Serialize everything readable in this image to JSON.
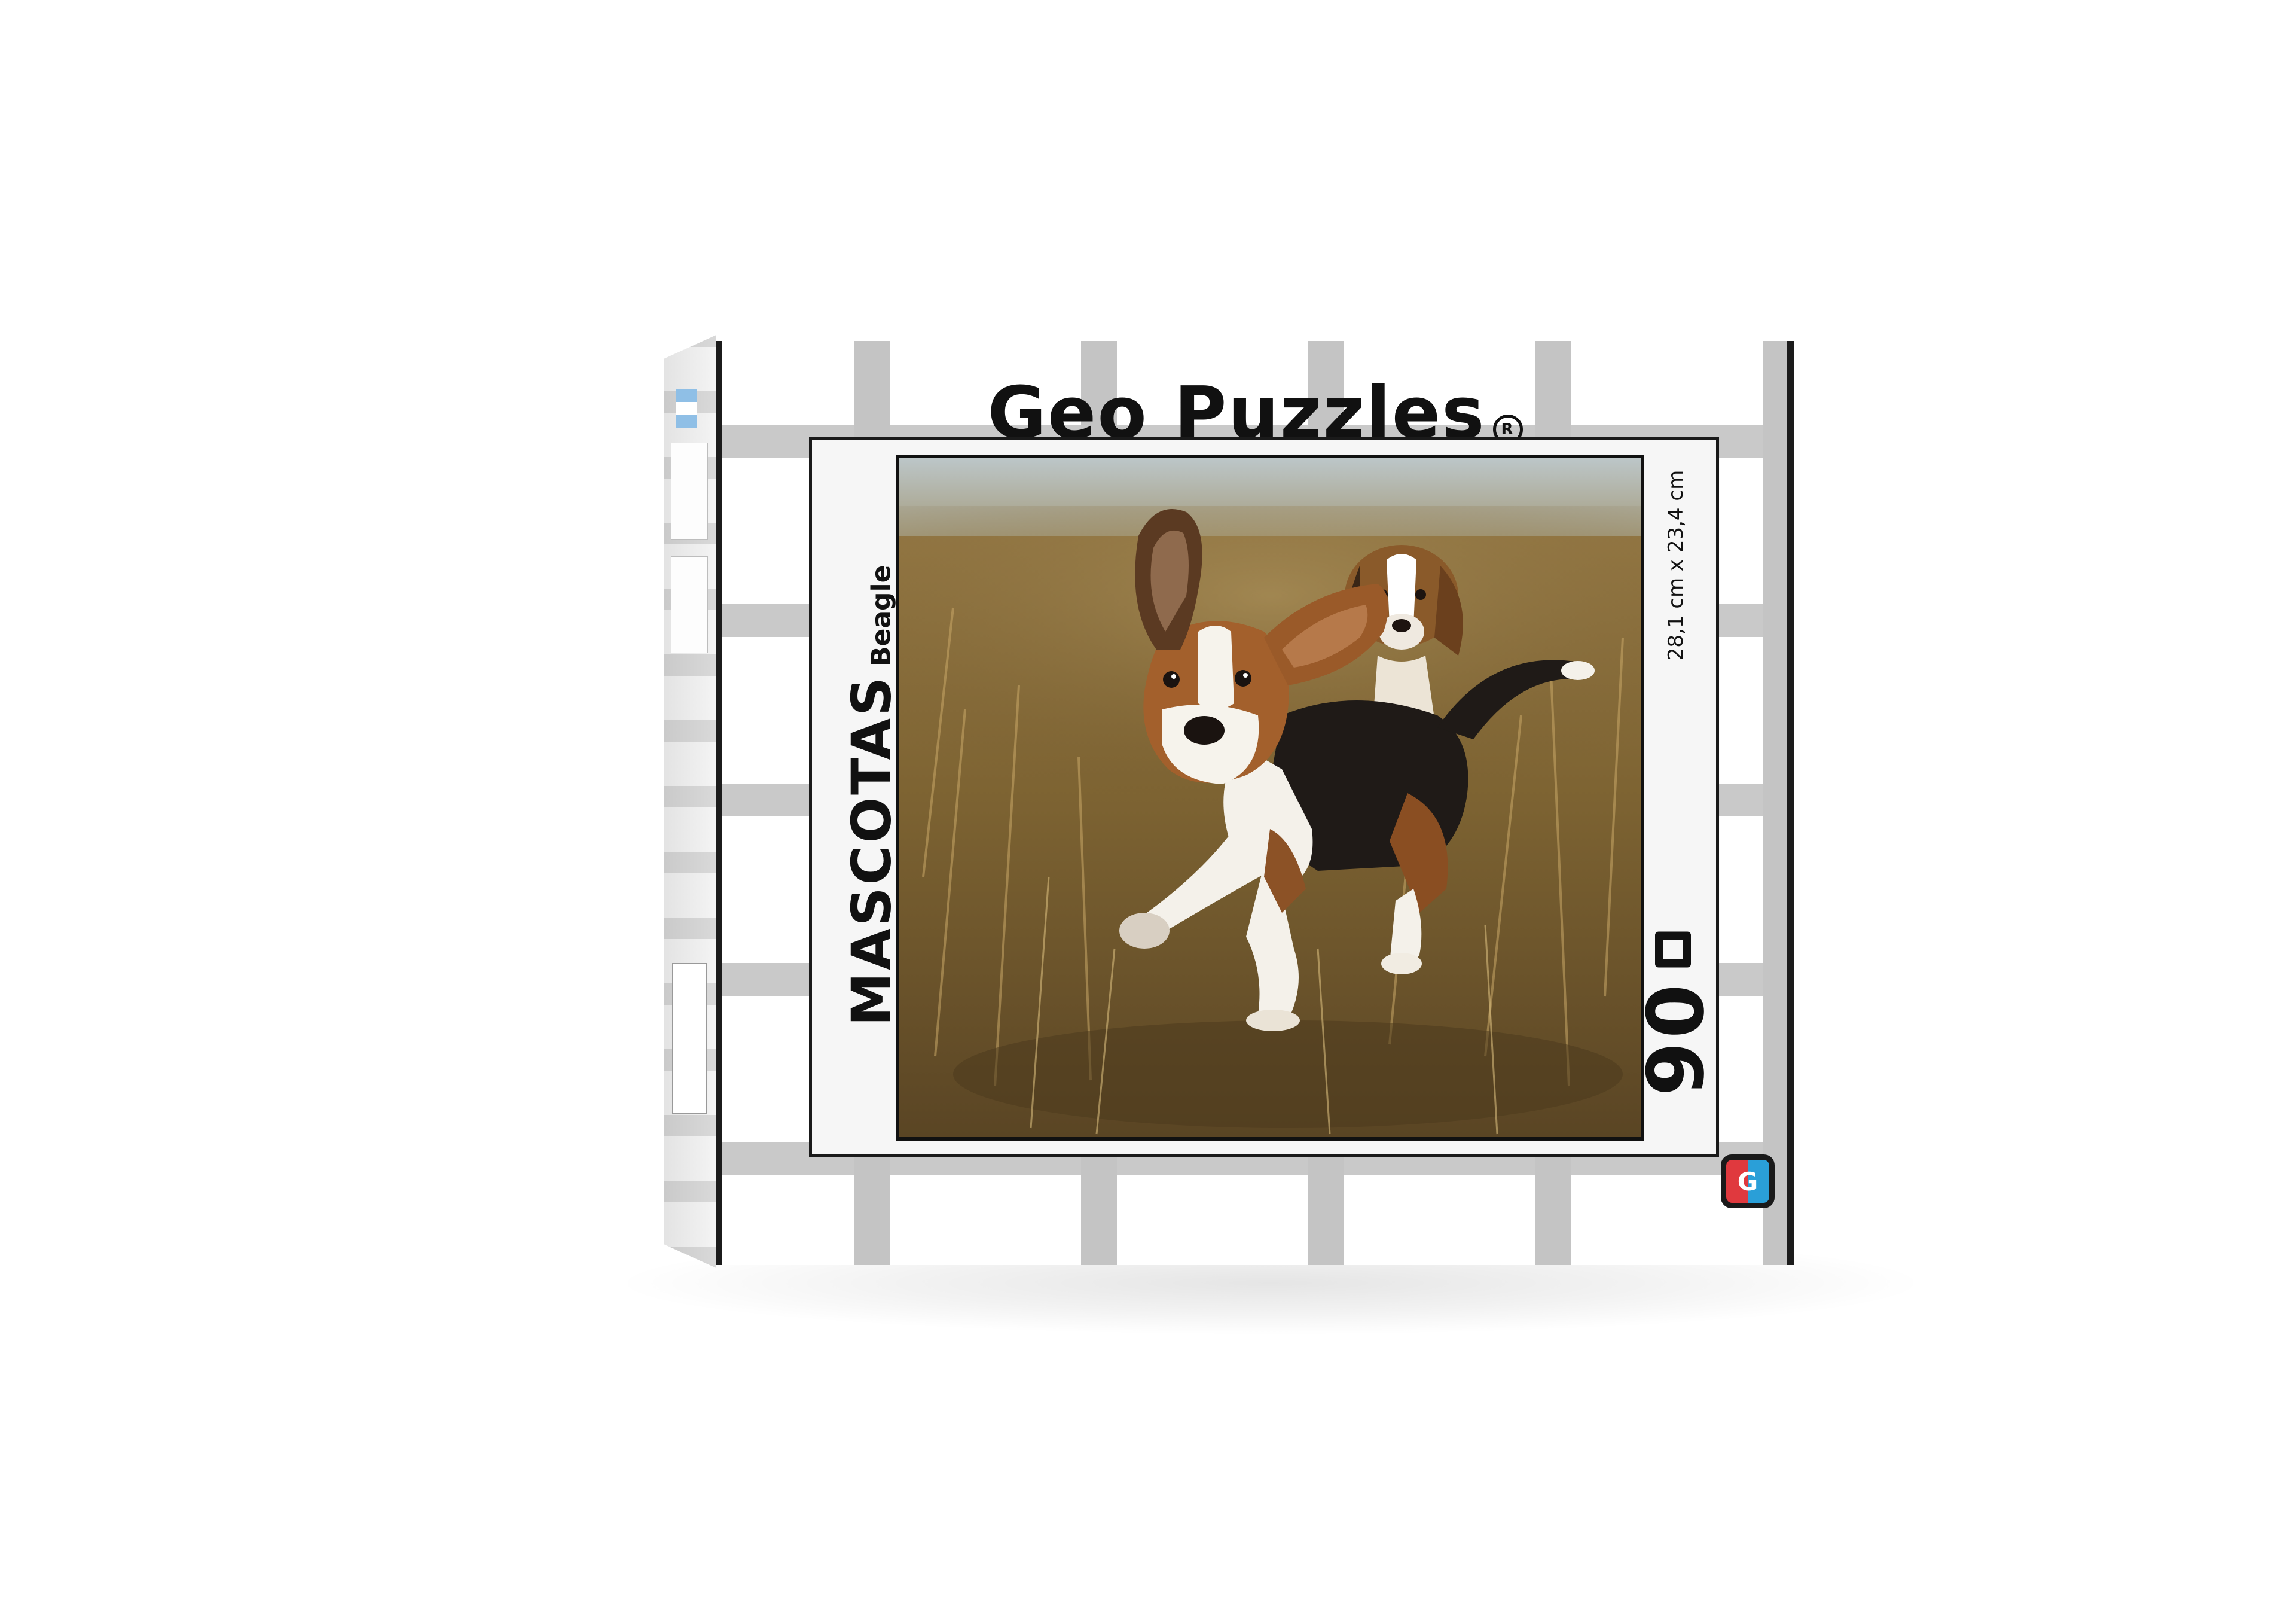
{
  "box": {
    "brand": "Geo Puzzles",
    "registered_mark": "R",
    "series_title": "MASCOTAS",
    "subtitle": "Beagle",
    "dimensions": "28,1 cm x 23,4 cm",
    "pieces": "90",
    "logo_letter": "G"
  },
  "colors": {
    "pattern_gray": "#c4c4c4",
    "border_black": "#1a1a1a",
    "card_bg": "#f6f6f6",
    "logo_red": "#e0393e",
    "logo_blue": "#2a9fd8",
    "flag_light_blue": "#8fbfe6"
  },
  "photo": {
    "subject": "beagle-puppies",
    "icons": [
      "puzzle-piece-icon",
      "registered-icon",
      "brand-logo-icon",
      "flag-icon"
    ]
  }
}
